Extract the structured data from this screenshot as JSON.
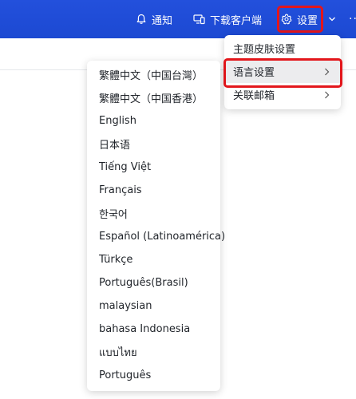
{
  "topbar": {
    "notify_label": "通知",
    "download_label": "下载客户端",
    "settings_label": "设置",
    "more_label": "···",
    "bg_color": "#1f4ed8"
  },
  "settings_menu": {
    "items": [
      {
        "label": "主题皮肤设置",
        "has_submenu": false
      },
      {
        "label": "语言设置",
        "has_submenu": true
      },
      {
        "label": "关联邮箱",
        "has_submenu": true
      }
    ]
  },
  "language_menu": {
    "items": [
      "繁體中文（中国台灣）",
      "繁體中文（中国香港）",
      "English",
      "日本语",
      "Tiếng Việt",
      "Français",
      "한국어",
      "Español (Latinoamérica)",
      "Türkçe",
      "Português(Brasil)",
      "malaysian",
      "bahasa Indonesia",
      "แบบไทย",
      "Português"
    ]
  },
  "highlight_color": "#e3161b"
}
